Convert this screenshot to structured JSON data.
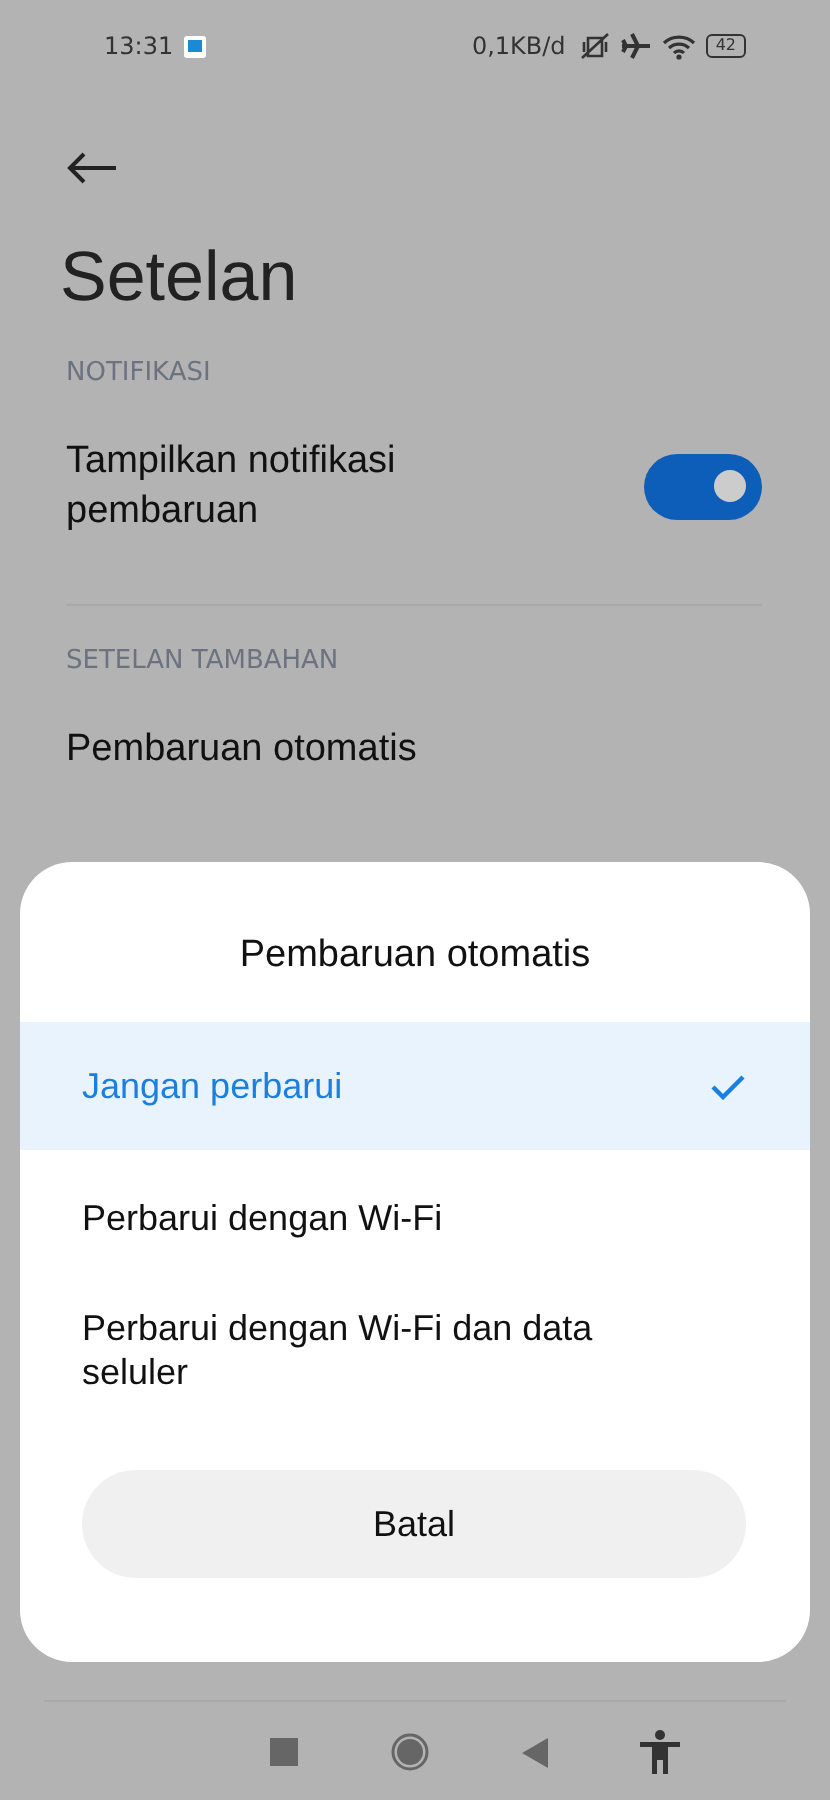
{
  "status_bar": {
    "time": "13:31",
    "data_rate": "0,1KB/d",
    "battery": "42"
  },
  "title": "Setelan",
  "sections": [
    {
      "header": "NOTIFIKASI",
      "items": [
        {
          "kind": "toggle",
          "label": "Tampilkan notifikasi pembaruan",
          "on": true
        }
      ]
    },
    {
      "header": "SETELAN TAMBAHAN",
      "items": [
        {
          "kind": "text",
          "label": "Pembaruan otomatis"
        }
      ]
    }
  ],
  "dialog": {
    "title": "Pembaruan otomatis",
    "options": [
      {
        "label": "Jangan perbarui",
        "selected": true
      },
      {
        "label": "Perbarui dengan Wi-Fi",
        "selected": false
      },
      {
        "label": "Perbarui dengan Wi-Fi dan data seluler",
        "selected": false
      }
    ],
    "cancel": "Batal"
  }
}
